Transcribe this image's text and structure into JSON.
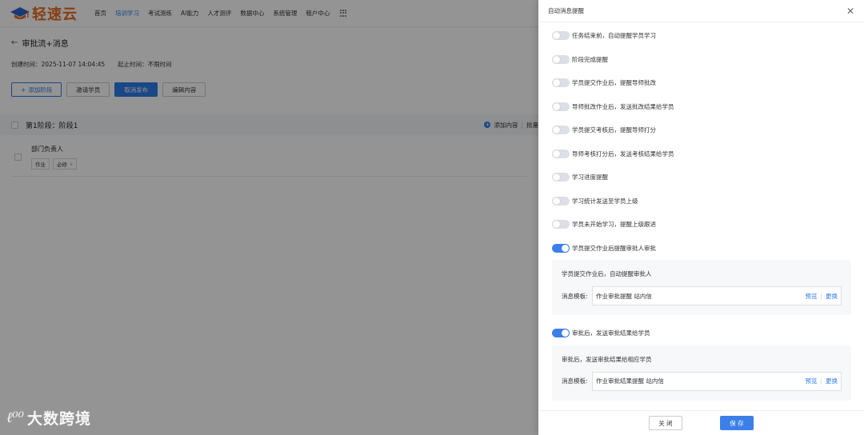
{
  "app": {
    "brand": "轻速云",
    "nav": [
      "首页",
      "培训学习",
      "考试测练",
      "AI能力",
      "人才测评",
      "数据中心",
      "系统管理",
      "租户中心"
    ],
    "nav_active_index": 1,
    "page_title": "审批流+消息",
    "created_label": "创建时间：2025-11-07 14:04:45",
    "period_label": "起止时间：不限时间",
    "buttons": {
      "add_stage": "添加阶段",
      "invite": "邀请学员",
      "cancel_publish": "取消发布",
      "edit_content": "编辑内容"
    },
    "stage": {
      "title": "第1阶段：阶段1",
      "add_content": "添加内容",
      "batch": "批量"
    },
    "item": {
      "name": "部门负责人",
      "tags": [
        "作业",
        "必修"
      ]
    }
  },
  "watermark": {
    "logo": "ℓ⁰⁰",
    "text": "大数跨境"
  },
  "drawer": {
    "title": "自动消息提醒",
    "toggles": [
      {
        "label": "任务结束前，自动提醒学员学习",
        "on": false
      },
      {
        "label": "阶段完成提醒",
        "on": false
      },
      {
        "label": "学员提交作业后，提醒导师批改",
        "on": false
      },
      {
        "label": "导师批改作业后，发送批改结果给学员",
        "on": false
      },
      {
        "label": "学员提交考核后，提醒导师打分",
        "on": false
      },
      {
        "label": "导师考核打分后，发送考核结果给学员",
        "on": false
      },
      {
        "label": "学习进度提醒",
        "on": false
      },
      {
        "label": "学习统计发送至学员上级",
        "on": false
      },
      {
        "label": "学员未开始学习，提醒上级跟进",
        "on": false
      },
      {
        "label": "学员提交作业后提醒审批人审批",
        "on": true,
        "detail": {
          "desc": "学员提交作业后，自动提醒审批人",
          "tpl_label": "消息模板:",
          "tpl_value": "作业审批提醒 站内信"
        }
      },
      {
        "label": "审批后，发送审批结果给学员",
        "on": true,
        "detail": {
          "desc": "审批后，发送审批结果给相应学员",
          "tpl_label": "消息模板:",
          "tpl_value": "作业审批结果提醒 站内信"
        }
      }
    ],
    "preview": "预览",
    "change": "更换",
    "footer": {
      "close": "关 闭",
      "save": "保 存"
    }
  },
  "colors": {
    "primary": "#2d7be5",
    "toggle_on": "#3c7fe8",
    "brand_orange": "#e86a1f"
  }
}
